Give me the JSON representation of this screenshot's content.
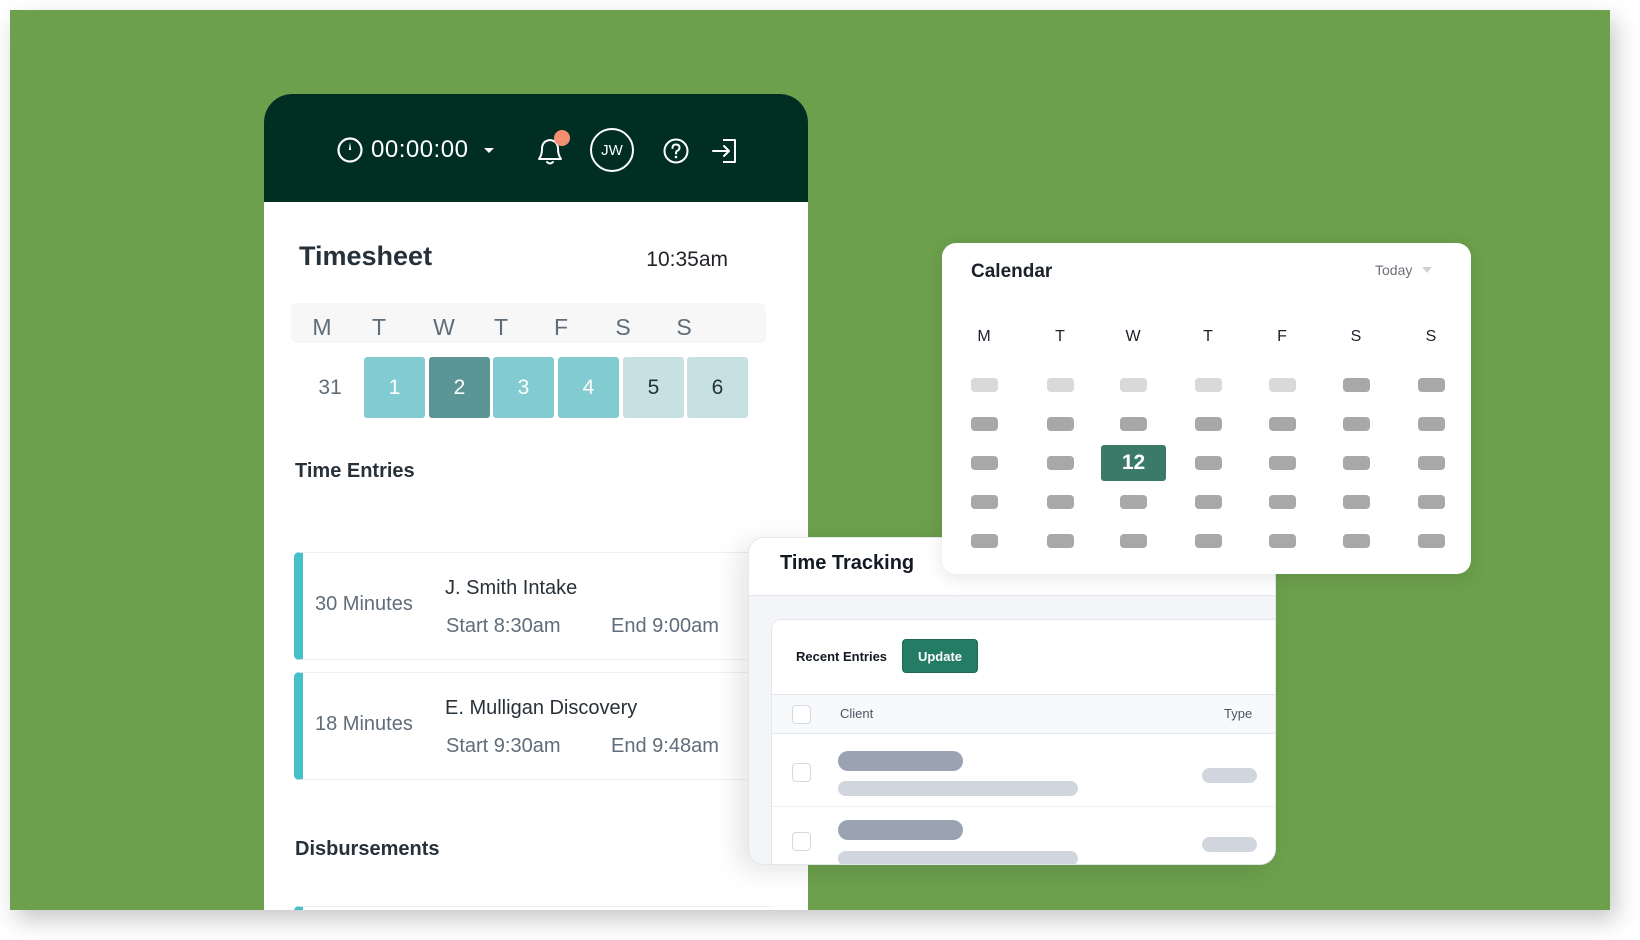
{
  "colors": {
    "background": "#6ca04c",
    "header_bg": "#012e23",
    "notification_dot": "#f48f74",
    "entry_accent": "#46bfc6",
    "primary_button": "#237c63",
    "calendar_today": "#3b7a68"
  },
  "header": {
    "timer_icon": "stopwatch-icon",
    "timer_value": "00:00:00",
    "timer_dropdown_icon": "caret-down-icon",
    "notification_icon": "bell-icon",
    "has_notification": true,
    "avatar_initials": "JW",
    "help_icon": "question-circle-icon",
    "logout_icon": "sign-in-arrow-icon"
  },
  "timesheet": {
    "title": "Timesheet",
    "current_time": "10:35am",
    "weekdays": [
      "M",
      "T",
      "W",
      "T",
      "F",
      "S",
      "S"
    ],
    "days": [
      {
        "label": "31",
        "state": "previous-month",
        "bg": "transparent",
        "fg": "#5f6c79"
      },
      {
        "label": "1",
        "state": "logged",
        "bg": "#82cbd1",
        "fg": "#ffffff"
      },
      {
        "label": "2",
        "state": "selected",
        "bg": "#5b9596",
        "fg": "#ffffff"
      },
      {
        "label": "3",
        "state": "logged",
        "bg": "#82cbd1",
        "fg": "#ffffff"
      },
      {
        "label": "4",
        "state": "logged",
        "bg": "#82cbd1",
        "fg": "#ffffff"
      },
      {
        "label": "5",
        "state": "weekend",
        "bg": "#c7e1e3",
        "fg": "#27313a"
      },
      {
        "label": "6",
        "state": "weekend",
        "bg": "#c7e1e3",
        "fg": "#27313a"
      }
    ],
    "time_entries_title": "Time Entries",
    "entries": [
      {
        "duration": "30 Minutes",
        "name": "J. Smith Intake",
        "start": "Start 8:30am",
        "end": "End 9:00am"
      },
      {
        "duration": "18 Minutes",
        "name": "E. Mulligan Discovery",
        "start": "Start 9:30am",
        "end": "End 9:48am"
      }
    ],
    "disbursements_title": "Disbursements"
  },
  "time_tracking": {
    "title": "Time Tracking",
    "recent_entries_label": "Recent Entries",
    "update_button": "Update",
    "columns": {
      "client": "Client",
      "type": "Type"
    },
    "row_count_visible": 2
  },
  "calendar": {
    "title": "Calendar",
    "view_select": "Today",
    "weekdays": [
      "M",
      "T",
      "W",
      "T",
      "F",
      "S",
      "S"
    ],
    "today": "12",
    "rows": [
      [
        "muted",
        "muted",
        "muted",
        "muted",
        "muted",
        "filled",
        "filled"
      ],
      [
        "filled",
        "filled",
        "filled",
        "filled",
        "filled",
        "filled",
        "filled"
      ],
      [
        "filled",
        "filled",
        "today",
        "filled",
        "filled",
        "filled",
        "filled"
      ],
      [
        "filled",
        "filled",
        "filled",
        "filled",
        "filled",
        "filled",
        "filled"
      ],
      [
        "filled",
        "filled",
        "filled",
        "filled",
        "filled",
        "filled",
        "filled"
      ]
    ]
  }
}
